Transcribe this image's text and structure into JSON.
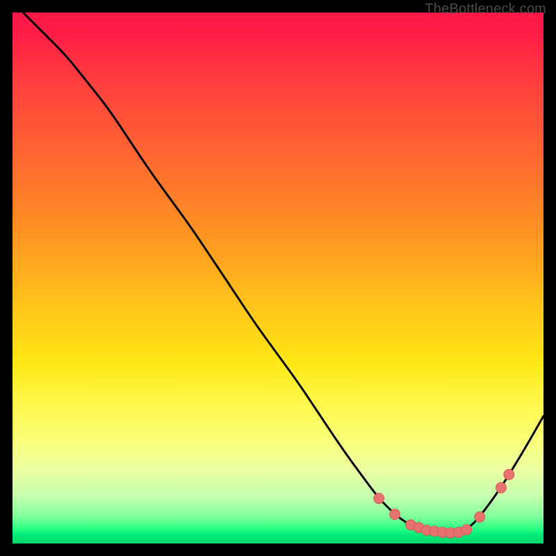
{
  "watermark": "TheBottleneck.com",
  "colors": {
    "page_bg": "#000000",
    "curve": "#000000",
    "marker_fill": "#e6736f",
    "marker_stroke": "#d85a56",
    "gradient_top": "#ff1848",
    "gradient_mid": "#ffe816",
    "gradient_bottom": "#00d86c"
  },
  "chart_data": {
    "type": "line",
    "title": "",
    "xlabel": "",
    "ylabel": "",
    "xlim": [
      0,
      100
    ],
    "ylim": [
      0,
      100
    ],
    "grid": false,
    "legend": false,
    "comment": "Curve shows bottleneck-style V shape; y ~ deviation from ideal. Values estimated from pixel positions.",
    "x": [
      2,
      6,
      10,
      14,
      18,
      22,
      26,
      30,
      34,
      38,
      42,
      46,
      50,
      54,
      58,
      62,
      66,
      69,
      72,
      74,
      76,
      78,
      80,
      82,
      84,
      86,
      88,
      92,
      96,
      100
    ],
    "y": [
      100,
      96,
      92,
      87,
      82,
      76,
      70,
      64.5,
      59,
      53,
      47,
      41,
      35.5,
      30,
      24,
      18,
      12.5,
      8.5,
      5.5,
      4,
      3,
      2.4,
      2.1,
      2,
      2.2,
      3,
      5,
      10.5,
      17,
      24
    ],
    "markers": [
      {
        "x": 69,
        "y": 8.5
      },
      {
        "x": 72,
        "y": 5.5
      },
      {
        "x": 75,
        "y": 3.5
      },
      {
        "x": 76.5,
        "y": 3
      },
      {
        "x": 78,
        "y": 2.5
      },
      {
        "x": 79.5,
        "y": 2.3
      },
      {
        "x": 81,
        "y": 2.1
      },
      {
        "x": 82.5,
        "y": 2.0
      },
      {
        "x": 84,
        "y": 2.1
      },
      {
        "x": 85.5,
        "y": 2.6
      },
      {
        "x": 88,
        "y": 5
      },
      {
        "x": 92,
        "y": 10.5
      },
      {
        "x": 93.5,
        "y": 13
      }
    ]
  }
}
